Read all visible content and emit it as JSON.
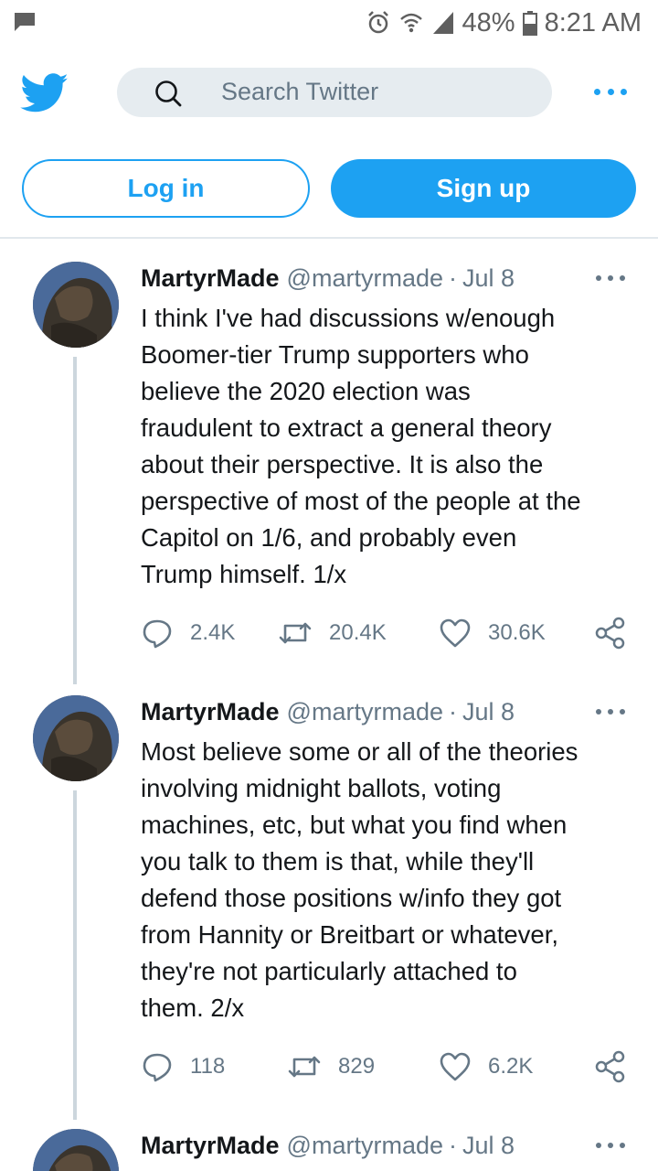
{
  "status_bar": {
    "battery": "48%",
    "time": "8:21 AM",
    "icons": [
      "message-icon",
      "alarm-icon",
      "wifi-icon",
      "signal-icon",
      "battery-icon"
    ]
  },
  "header": {
    "logo_icon": "twitter-bird-icon",
    "search_placeholder": "Search Twitter",
    "more_icon": "more-dots-icon"
  },
  "auth": {
    "login_label": "Log in",
    "signup_label": "Sign up"
  },
  "colors": {
    "accent": "#1da1f2",
    "text": "#14171a",
    "secondary": "#657786",
    "divider": "#e1e8ed"
  },
  "tweets": [
    {
      "name": "MartyrMade",
      "handle": "@martyrmade",
      "separator": "·",
      "date": "Jul 8",
      "text": "I think I've had discussions w/enough\nBoomer-tier Trump supporters who\nbelieve the 2020 election was\nfraudulent to extract a general theory\nabout their perspective. It is also the\nperspective of most of the people at the\nCapitol on 1/6, and probably even\nTrump himself. 1/x",
      "replies": "2.4K",
      "retweets": "20.4K",
      "likes": "30.6K"
    },
    {
      "name": "MartyrMade",
      "handle": "@martyrmade",
      "separator": "·",
      "date": "Jul 8",
      "text": "Most believe some or all of the theories\ninvolving midnight ballots, voting\nmachines, etc, but what you find when\nyou talk to them is that, while they'll\ndefend those positions w/info they got\nfrom Hannity or Breitbart or whatever,\nthey're not particularly attached to\nthem. 2/x",
      "replies": "118",
      "retweets": "829",
      "likes": "6.2K"
    },
    {
      "name": "MartyrMade",
      "handle": "@martyrmade",
      "separator": "·",
      "date": "Jul 8"
    }
  ]
}
